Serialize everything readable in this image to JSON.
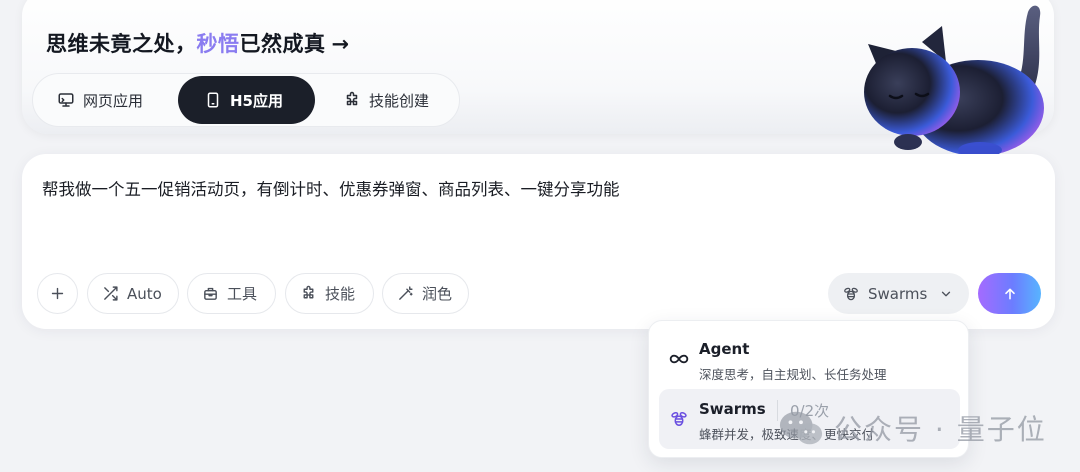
{
  "header": {
    "headline_prefix": "思维未竟之处，",
    "headline_accent": "秒悟",
    "headline_suffix": "已然成真",
    "headline_arrow": "→"
  },
  "modes": [
    {
      "label": "网页应用",
      "icon": "monitor-icon",
      "active": false
    },
    {
      "label": "H5应用",
      "icon": "mobile-icon",
      "active": true
    },
    {
      "label": "技能创建",
      "icon": "puzzle-icon",
      "active": false
    }
  ],
  "prompt": {
    "text": "帮我做一个五一促销活动页，有倒计时、优惠券弹窗、商品列表、一键分享功能"
  },
  "toolbar": {
    "add_icon": "plus-icon",
    "auto_label": "Auto",
    "tools_label": "工具",
    "skills_label": "技能",
    "polish_label": "润色"
  },
  "model_select": {
    "selected": "Swarms",
    "icon": "bee-icon"
  },
  "send": {
    "icon": "arrow-up-icon"
  },
  "dropdown": {
    "items": [
      {
        "title": "Agent",
        "desc": "深度思考，自主规划、长任务处理",
        "icon": "infinity-icon",
        "quota": ""
      },
      {
        "title": "Swarms",
        "desc": "蜂群并发，极致速度、更快交付",
        "icon": "bee-icon",
        "quota": "0/2次"
      }
    ]
  },
  "watermark": {
    "text": "公众号 · 量子位"
  },
  "colors": {
    "accent": "#8a7cf0",
    "active_tab_bg": "#1b1f29",
    "send_gradient_start": "#a46bff",
    "send_gradient_end": "#58b4ff",
    "page_bg": "#f2f3f6"
  }
}
